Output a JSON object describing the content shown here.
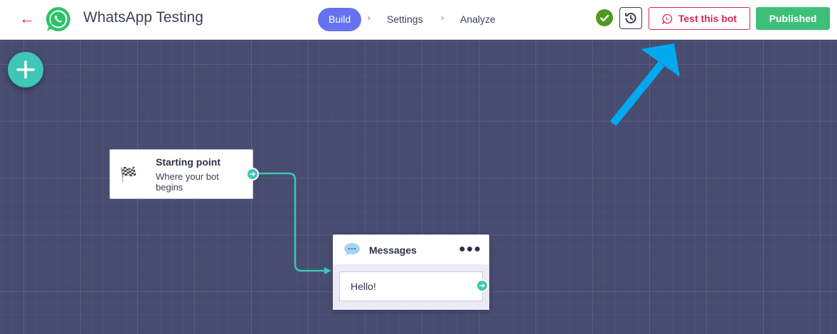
{
  "header": {
    "app_title": "WhatsApp Testing",
    "steps": [
      {
        "label": "Build",
        "active": true
      },
      {
        "label": "Settings",
        "active": false
      },
      {
        "label": "Analyze",
        "active": false
      }
    ],
    "test_button": "Test this bot",
    "published_button": "Published"
  },
  "nodes": {
    "start": {
      "title": "Starting point",
      "subtitle": "Where your bot begins",
      "icon": "checkered-flag-icon"
    },
    "messages": {
      "title": "Messages",
      "message_text": "Hello!",
      "icon": "chat-bubble-icon"
    }
  },
  "colors": {
    "accent": "#6672f0",
    "danger": "#d8245a",
    "success": "#3dbf7a",
    "teal": "#3ec6b6",
    "canvas": "#474c70",
    "arrow": "#00a9ee"
  }
}
